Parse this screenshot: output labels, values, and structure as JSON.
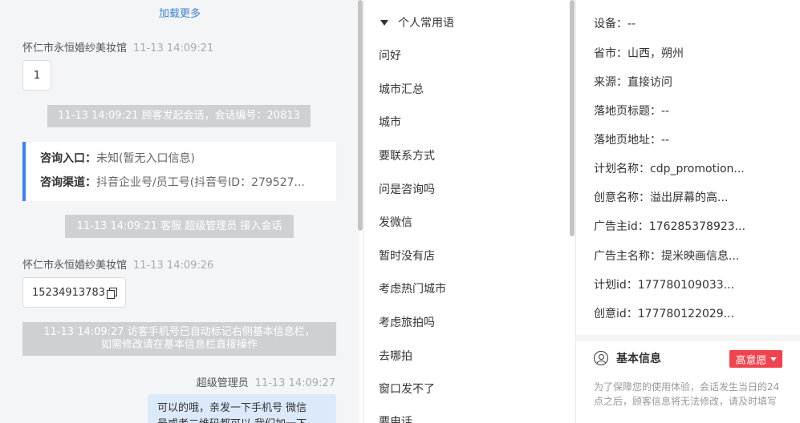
{
  "chat": {
    "load_more": "加载更多",
    "msg1": {
      "sender": "怀仁市永恒婚纱美妆馆",
      "time": "11-13 14:09:21",
      "text": "1"
    },
    "sys1": "11-13 14:09:21 顾客发起会话，会话编号：20813",
    "info_card": {
      "entry_label": "咨询入口：",
      "entry_value": "未知(暂无入口信息)",
      "channel_label": "咨询渠道：",
      "channel_value": "抖音企业号/员工号(抖音号ID：279527..."
    },
    "sys2": "11-13 14:09:21 客服 超级管理员 接入会话",
    "msg2": {
      "sender": "怀仁市永恒婚纱美妆馆",
      "time": "11-13 14:09:26",
      "text": "15234913783"
    },
    "sys3_line1": "11-13 14:09:27 访客手机号已自动标记右侧基本信息栏，",
    "sys3_line2": "如需修改请在基本信息栏直接操作",
    "msg3": {
      "sender": "超级管理员",
      "time": "11-13 14:09:27",
      "text_line1": "可以的哦，亲发一下手机号 微信",
      "text_line2": "号或者二维码都可以 我们加一下"
    }
  },
  "phrases": {
    "heading": "个人常用语",
    "items": [
      "问好",
      "城市汇总",
      "城市",
      "要联系方式",
      "问是咨询吗",
      "发微信",
      "暂时没有店",
      "考虑热门城市",
      "考虑旅拍吗",
      "去哪拍",
      "窗口发不了",
      "要电话"
    ]
  },
  "info": {
    "fields": [
      "设备：--",
      "省市：山西，朔州",
      "来源：直接访问",
      "落地页标题：--",
      "落地页地址：--",
      "计划名称：cdp_promotion...",
      "创意名称：溢出屏幕的高...",
      "广告主id：176285378923...",
      "广告主名称：提米映画信息...",
      "计划id：177780109033...",
      "创意id：177780122029..."
    ],
    "basic_title": "基本信息",
    "intent_badge": "高意愿",
    "notice": "为了保障您的使用体验，会话发生当日的24点之后，顾客信息将无法修改，请及时填写"
  }
}
